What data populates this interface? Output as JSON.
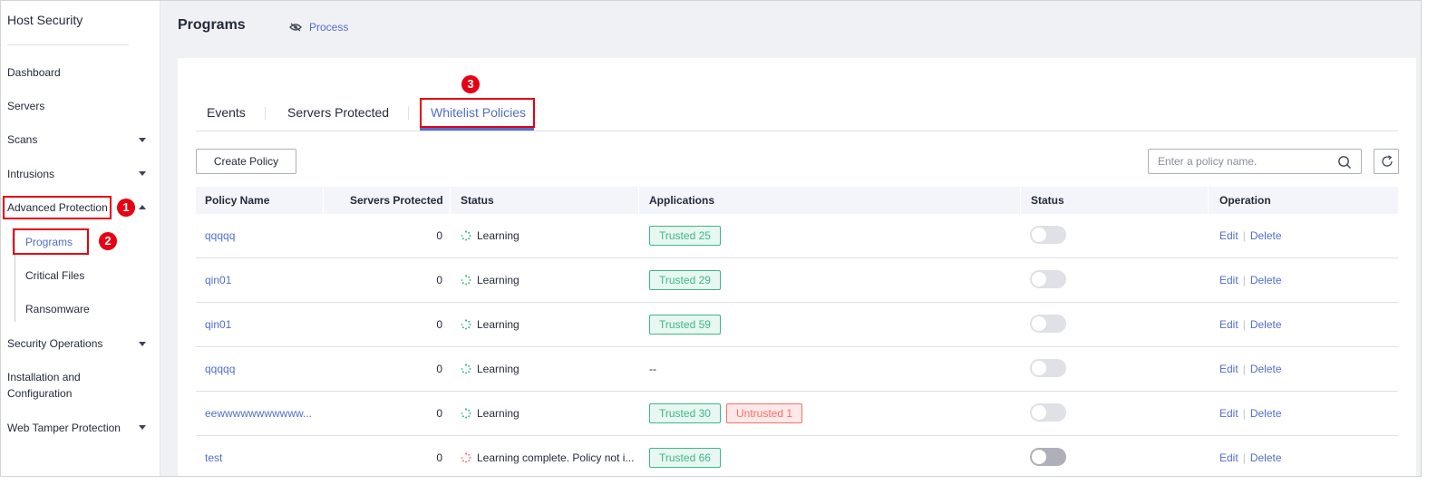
{
  "sidebar": {
    "title": "Host Security",
    "items": {
      "dashboard": "Dashboard",
      "servers": "Servers",
      "scans": "Scans",
      "intrusions": "Intrusions",
      "advanced_protection": "Advanced Protection",
      "programs": "Programs",
      "critical_files": "Critical Files",
      "ransomware": "Ransomware",
      "security_operations": "Security Operations",
      "installation_line1": "Installation and",
      "installation_line2": "Configuration",
      "web_tamper": "Web Tamper Protection"
    }
  },
  "annotations": {
    "badge1": "1",
    "badge2": "2",
    "badge3": "3"
  },
  "header": {
    "title": "Programs",
    "process_link": "Process"
  },
  "tabs": {
    "events": "Events",
    "servers_protected": "Servers Protected",
    "whitelist_policies": "Whitelist Policies"
  },
  "toolbar": {
    "create_policy": "Create Policy",
    "search_placeholder": "Enter a policy name."
  },
  "table": {
    "headers": {
      "policy_name": "Policy Name",
      "servers_protected": "Servers Protected",
      "status": "Status",
      "applications": "Applications",
      "status2": "Status",
      "operation": "Operation"
    },
    "rows": [
      {
        "name": "qqqqq",
        "servers": "0",
        "status": "Learning",
        "trusted": "Trusted  25",
        "untrusted": "",
        "apps_text": "",
        "edit": "Edit",
        "delete": "Delete"
      },
      {
        "name": "qin01",
        "servers": "0",
        "status": "Learning",
        "trusted": "Trusted  29",
        "untrusted": "",
        "apps_text": "",
        "edit": "Edit",
        "delete": "Delete"
      },
      {
        "name": "qin01",
        "servers": "0",
        "status": "Learning",
        "trusted": "Trusted  59",
        "untrusted": "",
        "apps_text": "",
        "edit": "Edit",
        "delete": "Delete"
      },
      {
        "name": "qqqqq",
        "servers": "0",
        "status": "Learning",
        "trusted": "",
        "untrusted": "",
        "apps_text": "--",
        "edit": "Edit",
        "delete": "Delete"
      },
      {
        "name": "eewwwwwwwwwww...",
        "servers": "0",
        "status": "Learning",
        "trusted": "Trusted  30",
        "untrusted": "Untrusted  1",
        "apps_text": "",
        "edit": "Edit",
        "delete": "Delete"
      },
      {
        "name": "test",
        "servers": "0",
        "status": "Learning complete. Policy not i...",
        "trusted": "Trusted  66",
        "untrusted": "",
        "apps_text": "",
        "edit": "Edit",
        "delete": "Delete"
      }
    ]
  },
  "colors": {
    "accent": "#526ecc",
    "highlight": "#e60012",
    "trusted": "#3cb88a",
    "untrusted": "#f66f6a",
    "learning_spinner": "#3cb88a",
    "complete_spinner": "#f66f6a"
  }
}
